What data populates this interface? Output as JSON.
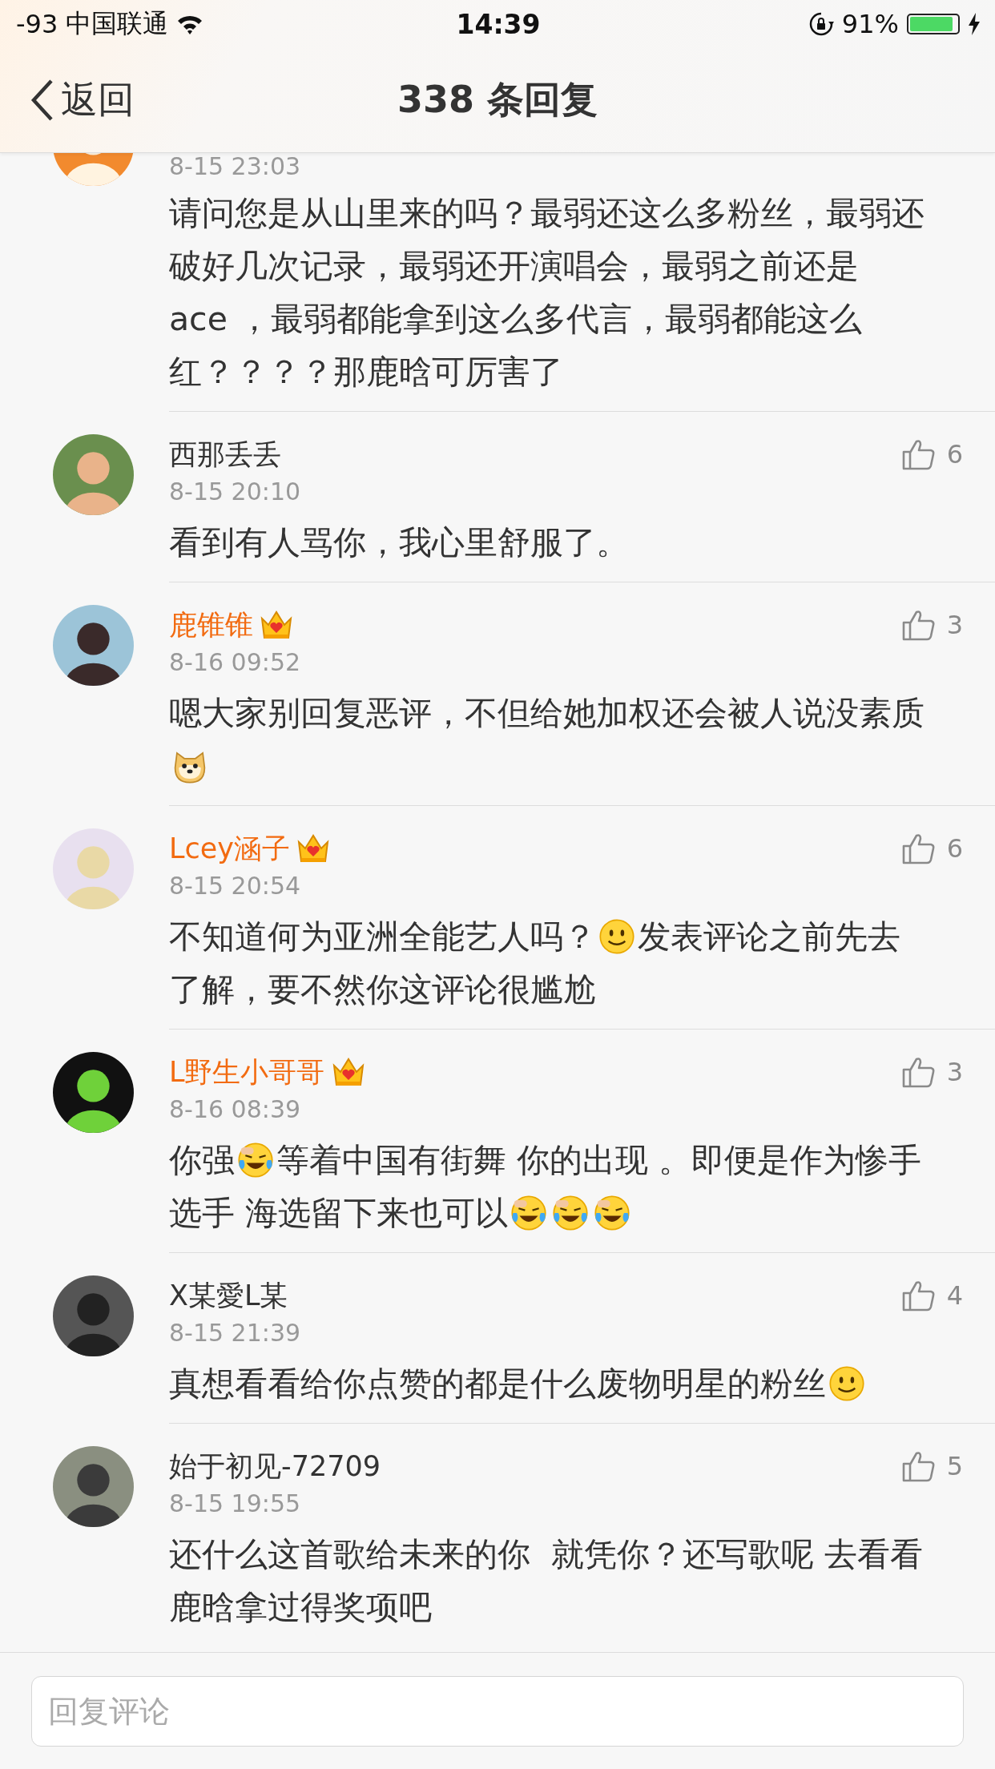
{
  "status_bar": {
    "signal": "-93",
    "carrier": "中国联通",
    "time": "14:39",
    "battery_text": "91%",
    "battery": {
      "level": 0.91,
      "charging": true
    }
  },
  "nav": {
    "back": "返回",
    "title": "338 条回复"
  },
  "comments": [
    {
      "date": "8-15 23:03",
      "lines": [
        [
          {
            "kind": "text",
            "text": "请问您是从山里来的吗？最弱还这么多粉丝，最弱还"
          }
        ],
        [
          {
            "kind": "text",
            "text": "破好几次记录，最弱还开演唱会，最弱之前还是"
          }
        ],
        [
          {
            "kind": "text",
            "text": "ace ，最弱都能拿到这么多代言，最弱都能这么"
          }
        ],
        [
          {
            "kind": "text",
            "text": "红？？？？那鹿晗可厉害了"
          }
        ]
      ]
    },
    {
      "name": "西那丢丢",
      "vip": false,
      "date": "8-15 20:10",
      "likes": "6",
      "lines": [
        [
          {
            "kind": "text",
            "text": "看到有人骂你，我心里舒服了。"
          }
        ]
      ]
    },
    {
      "name": "鹿锥锥",
      "vip": true,
      "date": "8-16 09:52",
      "likes": "3",
      "lines": [
        [
          {
            "kind": "text",
            "text": "嗯大家别回复恶评，不但给她加权还会被人说没素质"
          }
        ],
        [
          {
            "kind": "doge"
          }
        ]
      ]
    },
    {
      "name": "Lcey涵子",
      "vip": true,
      "date": "8-15 20:54",
      "likes": "6",
      "lines": [
        [
          {
            "kind": "text",
            "text": "不知道何为亚洲全能艺人吗？"
          },
          {
            "kind": "smile"
          },
          {
            "kind": "text",
            "text": "发表评论之前先去"
          }
        ],
        [
          {
            "kind": "text",
            "text": "了解，要不然你这评论很尴尬"
          }
        ]
      ]
    },
    {
      "name": "L野生小哥哥",
      "vip": true,
      "date": "8-16 08:39",
      "likes": "3",
      "lines": [
        [
          {
            "kind": "text",
            "text": "你强"
          },
          {
            "kind": "laugh_cry"
          },
          {
            "kind": "text",
            "text": "等着中国有街舞 你的出现 。即便是作为惨手"
          }
        ],
        [
          {
            "kind": "text",
            "text": "选手 海选留下来也可以"
          },
          {
            "kind": "laugh_cry"
          },
          {
            "kind": "laugh_cry"
          },
          {
            "kind": "laugh_cry"
          }
        ]
      ]
    },
    {
      "name": "X某愛L某",
      "vip": false,
      "date": "8-15 21:39",
      "likes": "4",
      "lines": [
        [
          {
            "kind": "text",
            "text": "真想看看给你点赞的都是什么废物明星的粉丝"
          },
          {
            "kind": "smile"
          }
        ]
      ]
    },
    {
      "name": "始于初见-72709",
      "vip": false,
      "date": "8-15 19:55",
      "likes": "5",
      "lines": [
        [
          {
            "kind": "text",
            "text": "还什么这首歌给未来的你  就凭你？还写歌呢 去看看"
          }
        ],
        [
          {
            "kind": "text",
            "text": "鹿晗拿过得奖项吧"
          }
        ]
      ]
    }
  ],
  "reply_field": {
    "placeholder": "回复评论"
  }
}
